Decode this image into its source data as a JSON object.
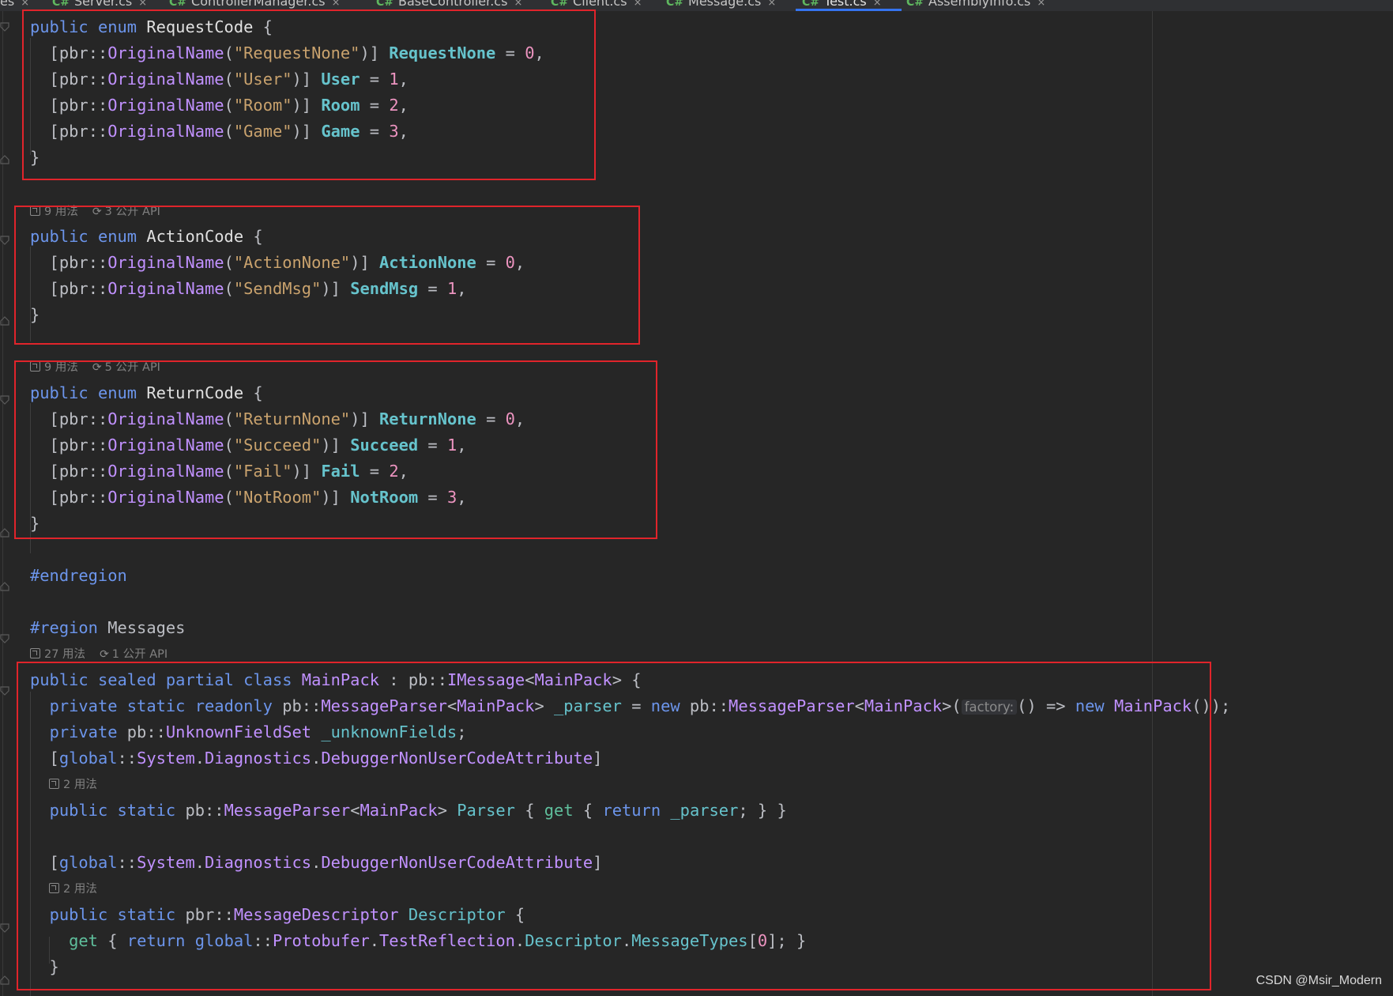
{
  "tabs": [
    {
      "prefix": "",
      "label": "es",
      "close": "×"
    },
    {
      "prefix": "C#",
      "label": "Server.cs",
      "close": "×"
    },
    {
      "prefix": "C#",
      "label": "ControllerManager.cs",
      "close": "×"
    },
    {
      "prefix": "C#",
      "label": "BaseController.cs",
      "close": "×"
    },
    {
      "prefix": "C#",
      "label": "Client.cs",
      "close": "×"
    },
    {
      "prefix": "C#",
      "label": "Message.cs",
      "close": "×"
    },
    {
      "prefix": "C#",
      "label": "Test.cs",
      "close": "×"
    },
    {
      "prefix": "C#",
      "label": "AssemblyInfo.cs",
      "close": "×"
    }
  ],
  "lens": {
    "action": {
      "usages": "9 用法",
      "api": "3 公开 API"
    },
    "ret": {
      "usages": "9 用法",
      "api": "5 公开 API"
    },
    "mainpack": {
      "usages": "27 用法",
      "api": "1 公开 API"
    },
    "parser": {
      "usages": "2 用法"
    },
    "descriptor": {
      "usages": "2 用法"
    }
  },
  "code": {
    "kw_public": "public",
    "kw_enum": "enum",
    "kw_sealed": "sealed",
    "kw_partial": "partial",
    "kw_class": "class",
    "kw_private": "private",
    "kw_static": "static",
    "kw_readonly": "readonly",
    "kw_new": "new",
    "kw_get": "get",
    "kw_return": "return",
    "kw_global": "global",
    "pbr": "pbr",
    "pb": "pb",
    "sep": "::",
    "original_name": "OriginalName",
    "request_code": "RequestCode",
    "action_code": "ActionCode",
    "return_code": "ReturnCode",
    "endregion": "#endregion",
    "region": "#region",
    "region_name": "Messages",
    "main_pack": "MainPack",
    "imessage": "IMessage",
    "message_parser": "MessageParser",
    "parser_field": "_parser",
    "factory_hint": "factory:",
    "unknown_field_set": "UnknownFieldSet",
    "unknown_fields": "_unknownFields",
    "system": "System",
    "diagnostics": "Diagnostics",
    "debugger_attr": "DebuggerNonUserCodeAttribute",
    "parser_prop": "Parser",
    "message_descriptor": "MessageDescriptor",
    "descriptor": "Descriptor",
    "protobufer": "Protobufer",
    "test_reflection": "TestReflection",
    "message_types": "MessageTypes",
    "zero": "0",
    "req": [
      {
        "str": "\"RequestNone\"",
        "name": "RequestNone",
        "val": "0"
      },
      {
        "str": "\"User\"",
        "name": "User",
        "val": "1"
      },
      {
        "str": "\"Room\"",
        "name": "Room",
        "val": "2"
      },
      {
        "str": "\"Game\"",
        "name": "Game",
        "val": "3"
      }
    ],
    "act": [
      {
        "str": "\"ActionNone\"",
        "name": "ActionNone",
        "val": "0"
      },
      {
        "str": "\"SendMsg\"",
        "name": "SendMsg",
        "val": "1"
      }
    ],
    "ret": [
      {
        "str": "\"ReturnNone\"",
        "name": "ReturnNone",
        "val": "0"
      },
      {
        "str": "\"Succeed\"",
        "name": "Succeed",
        "val": "1"
      },
      {
        "str": "\"Fail\"",
        "name": "Fail",
        "val": "2"
      },
      {
        "str": "\"NotRoom\"",
        "name": "NotRoom",
        "val": "3"
      }
    ]
  },
  "watermark": "CSDN @Msir_Modern",
  "colors": {
    "highlight_box": "#e0242b",
    "keyword": "#6c95eb",
    "string": "#c9a26d",
    "number": "#ed94c0",
    "type": "#c191ff",
    "member": "#66c3cc"
  }
}
